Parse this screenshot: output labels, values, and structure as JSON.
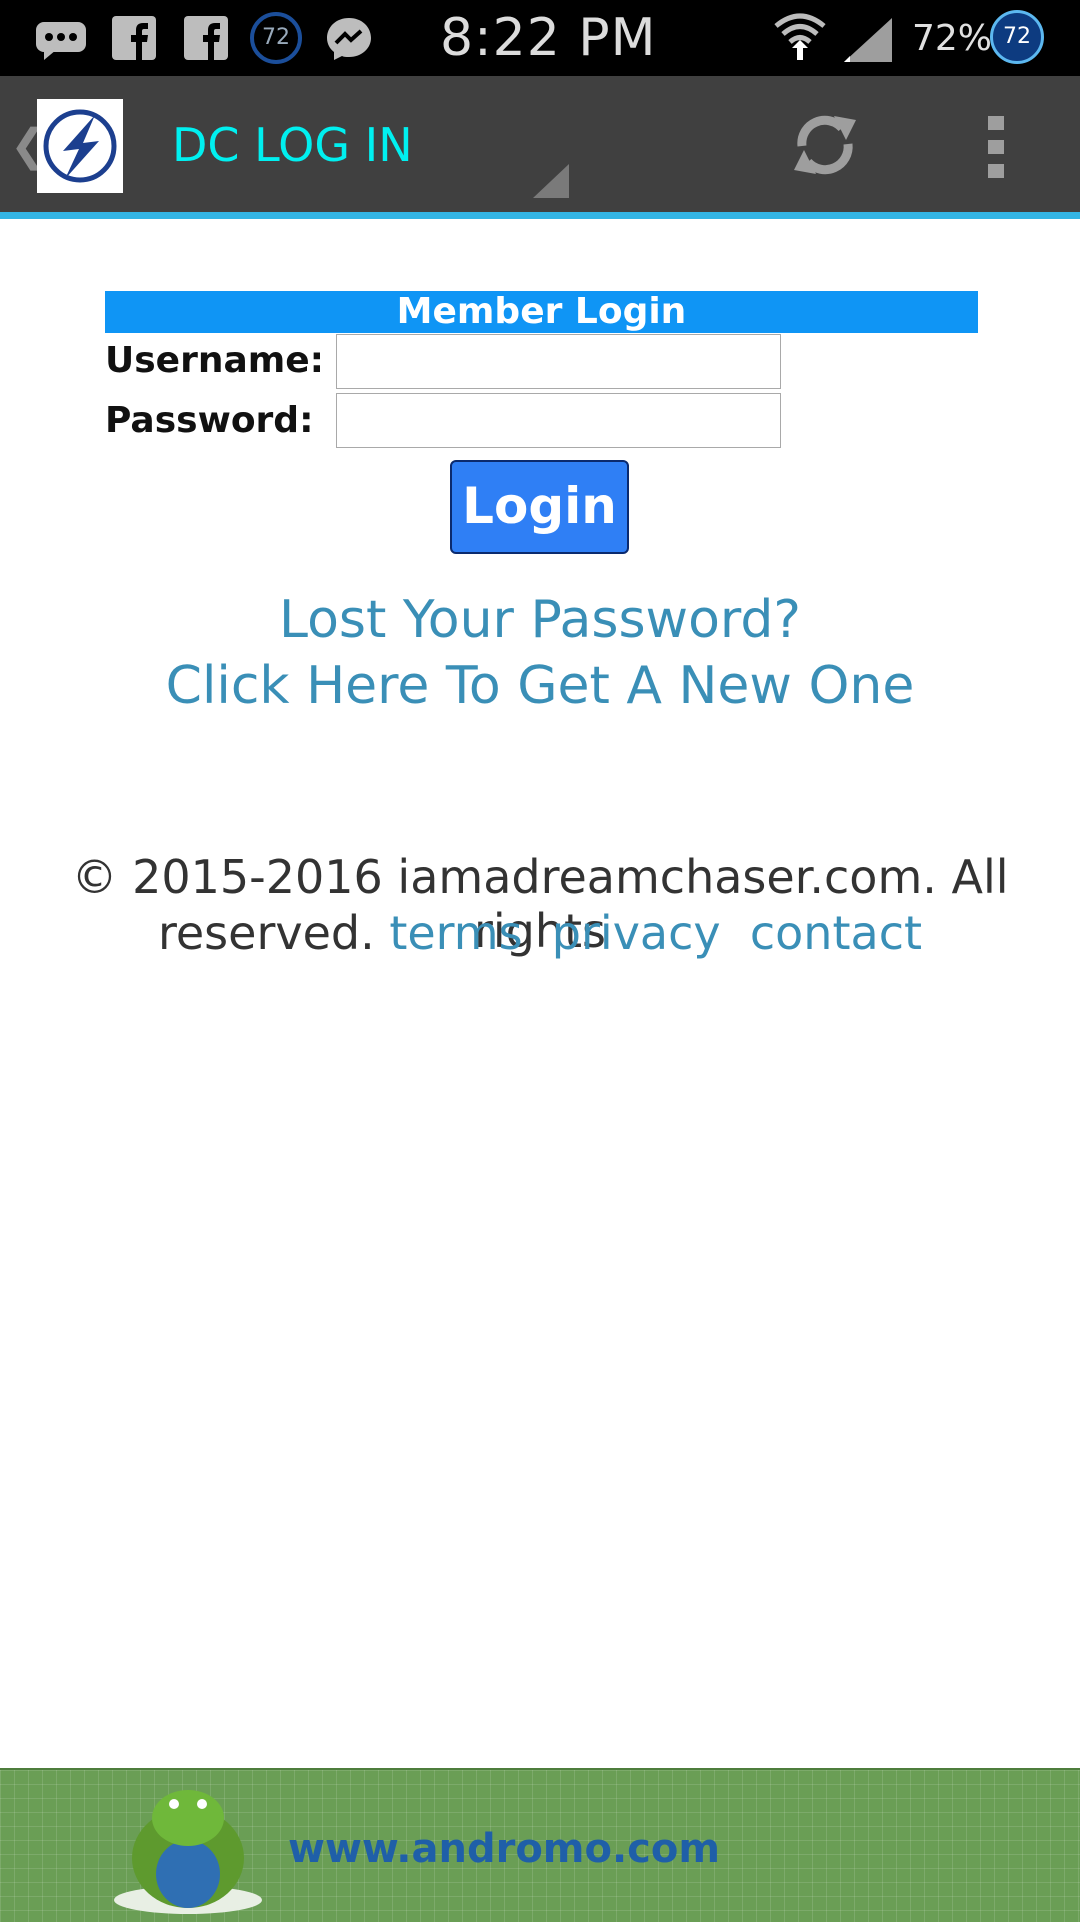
{
  "status_bar": {
    "time": "8:22 PM",
    "battery_percent": "72%",
    "badge_left": "72",
    "badge_right": "72",
    "icons": [
      "sms-icon",
      "facebook-icon",
      "facebook-icon",
      "weather-badge-icon",
      "messenger-icon",
      "wifi-icon",
      "signal-icon",
      "battery-badge-icon"
    ]
  },
  "action_bar": {
    "title": "DC LOG IN",
    "icons": [
      "up-chevron-icon",
      "app-logo-icon",
      "spinner-arrow-icon",
      "refresh-icon",
      "overflow-menu-icon"
    ],
    "accent_color": "#33b5e5",
    "title_color": "#00f0f0"
  },
  "login": {
    "header": "Member Login",
    "username_label": "Username:",
    "username_value": "",
    "password_label": "Password:",
    "password_value": "",
    "button_label": "Login",
    "header_color": "#0f95f5",
    "button_color": "#2f7ff5"
  },
  "recovery": {
    "line1": "Lost Your Password?",
    "line2": "Click Here To Get A New One"
  },
  "footer": {
    "copyright_line1": "© 2015-2016 iamadreamchaser.com. All rights",
    "copyright_line2": "reserved.",
    "links": [
      "terms",
      "privacy",
      "contact"
    ]
  },
  "ad_banner": {
    "text": "www.andromo.com",
    "icon": "android-mascot-icon"
  }
}
